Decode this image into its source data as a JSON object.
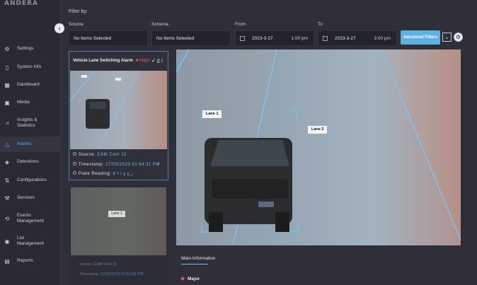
{
  "app": {
    "logo_text": "ANDERA"
  },
  "sidebar": {
    "items": [
      {
        "label": "Settings",
        "icon": "gear-icon"
      },
      {
        "label": "System Info",
        "icon": "info-icon"
      },
      {
        "label": "Dashboard",
        "icon": "grid-icon"
      },
      {
        "label": "Media",
        "icon": "media-icon"
      },
      {
        "label": "Insights & Statistics",
        "icon": "chart-icon"
      },
      {
        "label": "Alarms",
        "icon": "warning-icon",
        "active": true
      },
      {
        "label": "Detections",
        "icon": "target-icon"
      },
      {
        "label": "Configurations",
        "icon": "sliders-icon"
      },
      {
        "label": "Services",
        "icon": "services-icon"
      },
      {
        "label": "Events Management",
        "icon": "events-icon"
      },
      {
        "label": "List Management",
        "icon": "list-icon"
      },
      {
        "label": "Reports",
        "icon": "report-icon"
      }
    ]
  },
  "filters": {
    "title": "Filter by:",
    "source": {
      "label": "Source",
      "value": "No Items Selected"
    },
    "schema": {
      "label": "Schema",
      "value": "No Items Selected"
    },
    "from": {
      "label": "From",
      "date": "2023-3-27",
      "time": "1:00 pm"
    },
    "to": {
      "label": "To",
      "date": "2023-3-27",
      "time": "3:00 pm"
    },
    "advanced_label": "Advanced Filters"
  },
  "alarm_list": [
    {
      "title": "Vehicle Lane Switching Alarm",
      "severity": "Major",
      "source_label": "Source:",
      "source": "CAM Cont 12",
      "timestamp_label": "Timestamp:",
      "timestamp": "27/03/2023 01:54:31 PM",
      "plate_label": "Plate Reading:",
      "plate": "ر ج ع ١ ٦ ٥"
    },
    {
      "source_label": "Source:",
      "source": "CAM Cont 11",
      "timestamp_label": "Timestamp:",
      "timestamp": "27/03/2023 01:53:06 PM",
      "lane_tag": "Lane 1"
    }
  ],
  "viewer": {
    "lane1": "Lane 1",
    "lane2": "Lane 2"
  },
  "details": {
    "tab": "Main Information",
    "severity": "Major"
  },
  "colors": {
    "accent": "#6cc1f2",
    "active_nav": "#4fb4ff",
    "major": "#e35b5b"
  }
}
